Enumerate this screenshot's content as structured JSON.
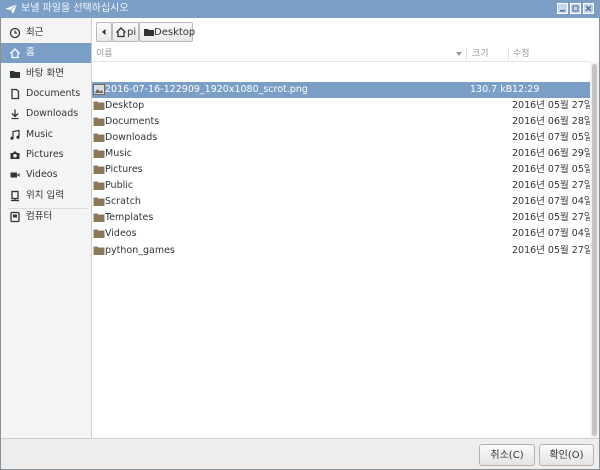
{
  "window": {
    "title": "보낼 파일을 선택하십시오",
    "app_icon": "paper-plane-icon",
    "controls": [
      "minimize-icon",
      "maximize-icon",
      "close-icon"
    ]
  },
  "sidebar": {
    "items": [
      {
        "label": "최근",
        "icon": "clock-icon",
        "selected": false
      },
      {
        "label": "홈",
        "icon": "home-icon",
        "selected": true
      },
      {
        "label": "바탕 화면",
        "icon": "folder-icon",
        "selected": false
      },
      {
        "label": "Documents",
        "icon": "document-icon",
        "selected": false
      },
      {
        "label": "Downloads",
        "icon": "download-icon",
        "selected": false
      },
      {
        "label": "Music",
        "icon": "music-icon",
        "selected": false
      },
      {
        "label": "Pictures",
        "icon": "camera-icon",
        "selected": false
      },
      {
        "label": "Videos",
        "icon": "video-icon",
        "selected": false
      },
      {
        "label": "위치 입력",
        "icon": "location-icon",
        "selected": false
      },
      {
        "label": "컴퓨터",
        "icon": "computer-icon",
        "selected": false
      }
    ]
  },
  "pathbar": {
    "back_icon": "arrow-left-icon",
    "segments": [
      {
        "label": "pi",
        "icon": "home-icon"
      },
      {
        "label": "Desktop",
        "icon": "folder-icon"
      }
    ]
  },
  "filelist": {
    "columns": {
      "name": "이름",
      "size": "크기",
      "modified": "수정"
    },
    "sort_icon": "sort-down-icon",
    "rows": [
      {
        "name": "2016-07-16-122909_1920x1080_scrot.png",
        "size": "130.7 kB",
        "modified": "12:29",
        "type": "image",
        "selected": true
      },
      {
        "name": "Desktop",
        "size": "",
        "modified": "2016년 05월 27일",
        "type": "folder",
        "selected": false
      },
      {
        "name": "Documents",
        "size": "",
        "modified": "2016년 06월 28일",
        "type": "folder",
        "selected": false
      },
      {
        "name": "Downloads",
        "size": "",
        "modified": "2016년 07월 05일",
        "type": "folder",
        "selected": false
      },
      {
        "name": "Music",
        "size": "",
        "modified": "2016년 06월 29일",
        "type": "folder",
        "selected": false
      },
      {
        "name": "Pictures",
        "size": "",
        "modified": "2016년 07월 05일",
        "type": "folder",
        "selected": false
      },
      {
        "name": "Public",
        "size": "",
        "modified": "2016년 05월 27일",
        "type": "folder",
        "selected": false
      },
      {
        "name": "Scratch",
        "size": "",
        "modified": "2016년 07월 04일",
        "type": "folder",
        "selected": false
      },
      {
        "name": "Templates",
        "size": "",
        "modified": "2016년 05월 27일",
        "type": "folder",
        "selected": false
      },
      {
        "name": "Videos",
        "size": "",
        "modified": "2016년 07월 04일",
        "type": "folder",
        "selected": false
      },
      {
        "name": "python_games",
        "size": "",
        "modified": "2016년 05월 27일",
        "type": "folder",
        "selected": false
      }
    ]
  },
  "buttons": {
    "cancel": "취소(C)",
    "ok": "확인(O)"
  },
  "colors": {
    "accent": "#7b9ec7",
    "folder": "#8a7a5a"
  }
}
